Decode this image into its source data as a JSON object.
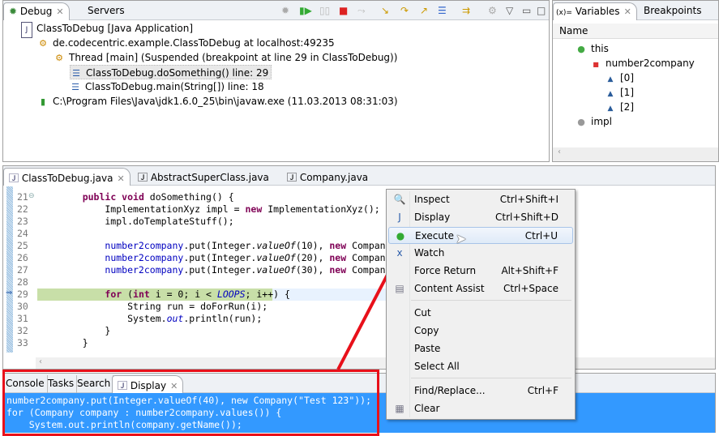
{
  "debug": {
    "tabs": [
      {
        "label": "Debug",
        "active": true
      },
      {
        "label": "Servers"
      }
    ],
    "tree": [
      {
        "icon": "java-app-icon",
        "label": "ClassToDebug [Java Application]",
        "indent": 0
      },
      {
        "icon": "debug-target-icon",
        "label": "de.codecentric.example.ClassToDebug at localhost:49235",
        "indent": 1
      },
      {
        "icon": "suspended-thread-icon",
        "label": "Thread [main] (Suspended (breakpoint at line 29 in ClassToDebug))",
        "indent": 2
      },
      {
        "icon": "stack-frame-icon",
        "label": "ClassToDebug.doSomething() line: 29",
        "indent": 3,
        "selected": true
      },
      {
        "icon": "stack-frame-icon",
        "label": "ClassToDebug.main(String[]) line: 18",
        "indent": 3
      },
      {
        "icon": "process-icon",
        "label": "C:\\Program Files\\Java\\jdk1.6.0_25\\bin\\javaw.exe (11.03.2013 08:31:03)",
        "indent": 1
      }
    ]
  },
  "variables": {
    "tabs": [
      {
        "label": "Variables",
        "active": true
      },
      {
        "label": "Breakpoints"
      }
    ],
    "column": "Name",
    "rows": [
      {
        "label": "this",
        "icon": "green-circle",
        "indent": 0
      },
      {
        "label": "number2company",
        "icon": "red-square",
        "indent": 1
      },
      {
        "label": "[0]",
        "icon": "blue-triangle",
        "indent": 2
      },
      {
        "label": "[1]",
        "icon": "blue-triangle",
        "indent": 2
      },
      {
        "label": "[2]",
        "icon": "blue-triangle",
        "indent": 2
      },
      {
        "label": "impl",
        "icon": "gray-circle",
        "indent": 0
      }
    ]
  },
  "editor": {
    "tabs": [
      {
        "label": "ClassToDebug.java",
        "active": true
      },
      {
        "label": "AbstractSuperClass.java"
      },
      {
        "label": "Company.java"
      }
    ],
    "line_numbers": [
      "21",
      "22",
      "23",
      "24",
      "25",
      "26",
      "27",
      "28",
      "29",
      "30",
      "31",
      "32",
      "33"
    ],
    "current_line": "29"
  },
  "bottom": {
    "tabs": [
      {
        "label": "Console"
      },
      {
        "label": "Tasks"
      },
      {
        "label": "Search"
      },
      {
        "label": "Display",
        "active": true
      }
    ],
    "lines": [
      "number2company.put(Integer.valueOf(40), new Company(\"Test 123\"));",
      "for (Company company : number2company.values()) {",
      "    System.out.println(company.getName());"
    ]
  },
  "menu": {
    "items": [
      {
        "label": "Inspect",
        "shortcut": "Ctrl+Shift+I",
        "icon": "magnifier-icon"
      },
      {
        "label": "Display",
        "shortcut": "Ctrl+Shift+D",
        "icon": "display-icon"
      },
      {
        "label": "Execute",
        "shortcut": "Ctrl+U",
        "icon": "execute-icon",
        "highlighted": true
      },
      {
        "label": "Watch",
        "shortcut": "",
        "icon": "watch-icon"
      },
      {
        "label": "Force Return",
        "shortcut": "Alt+Shift+F",
        "icon": ""
      },
      {
        "label": "Content Assist",
        "shortcut": "Ctrl+Space",
        "icon": "content-assist-icon"
      },
      {
        "label": "Cut",
        "shortcut": ""
      },
      {
        "label": "Copy",
        "shortcut": ""
      },
      {
        "label": "Paste",
        "shortcut": ""
      },
      {
        "label": "Select All",
        "shortcut": ""
      },
      {
        "label": "Find/Replace...",
        "shortcut": "Ctrl+F"
      },
      {
        "label": "Clear",
        "shortcut": "",
        "icon": "clear-icon"
      }
    ]
  },
  "colors": {
    "annotation": "#e8101a",
    "selection": "#3399ff",
    "current_line": "#c8dfa8"
  }
}
